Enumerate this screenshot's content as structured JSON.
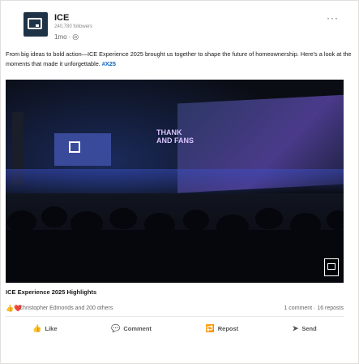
{
  "post": {
    "author": "ICE",
    "followers": "240,780 followers",
    "time": "1mo",
    "globe_icon": "globe-icon",
    "text": "From big ideas to bold action—ICE Experience 2025 brought us together to shape the future of homeownership. Here's a look at the moments that made it unforgettable.",
    "hashtag": "#X25",
    "screen_text": "THANK\nAND FANS"
  },
  "media": {
    "caption": "ICE Experience 2025 Highlights"
  },
  "social": {
    "reactions_icons": "👍❤️",
    "reactors": "Christopher Edmonds and 200 others",
    "stats": "1 comment · 16 reposts"
  },
  "actions": {
    "like": "Like",
    "comment": "Comment",
    "repost": "Repost",
    "send": "Send"
  }
}
